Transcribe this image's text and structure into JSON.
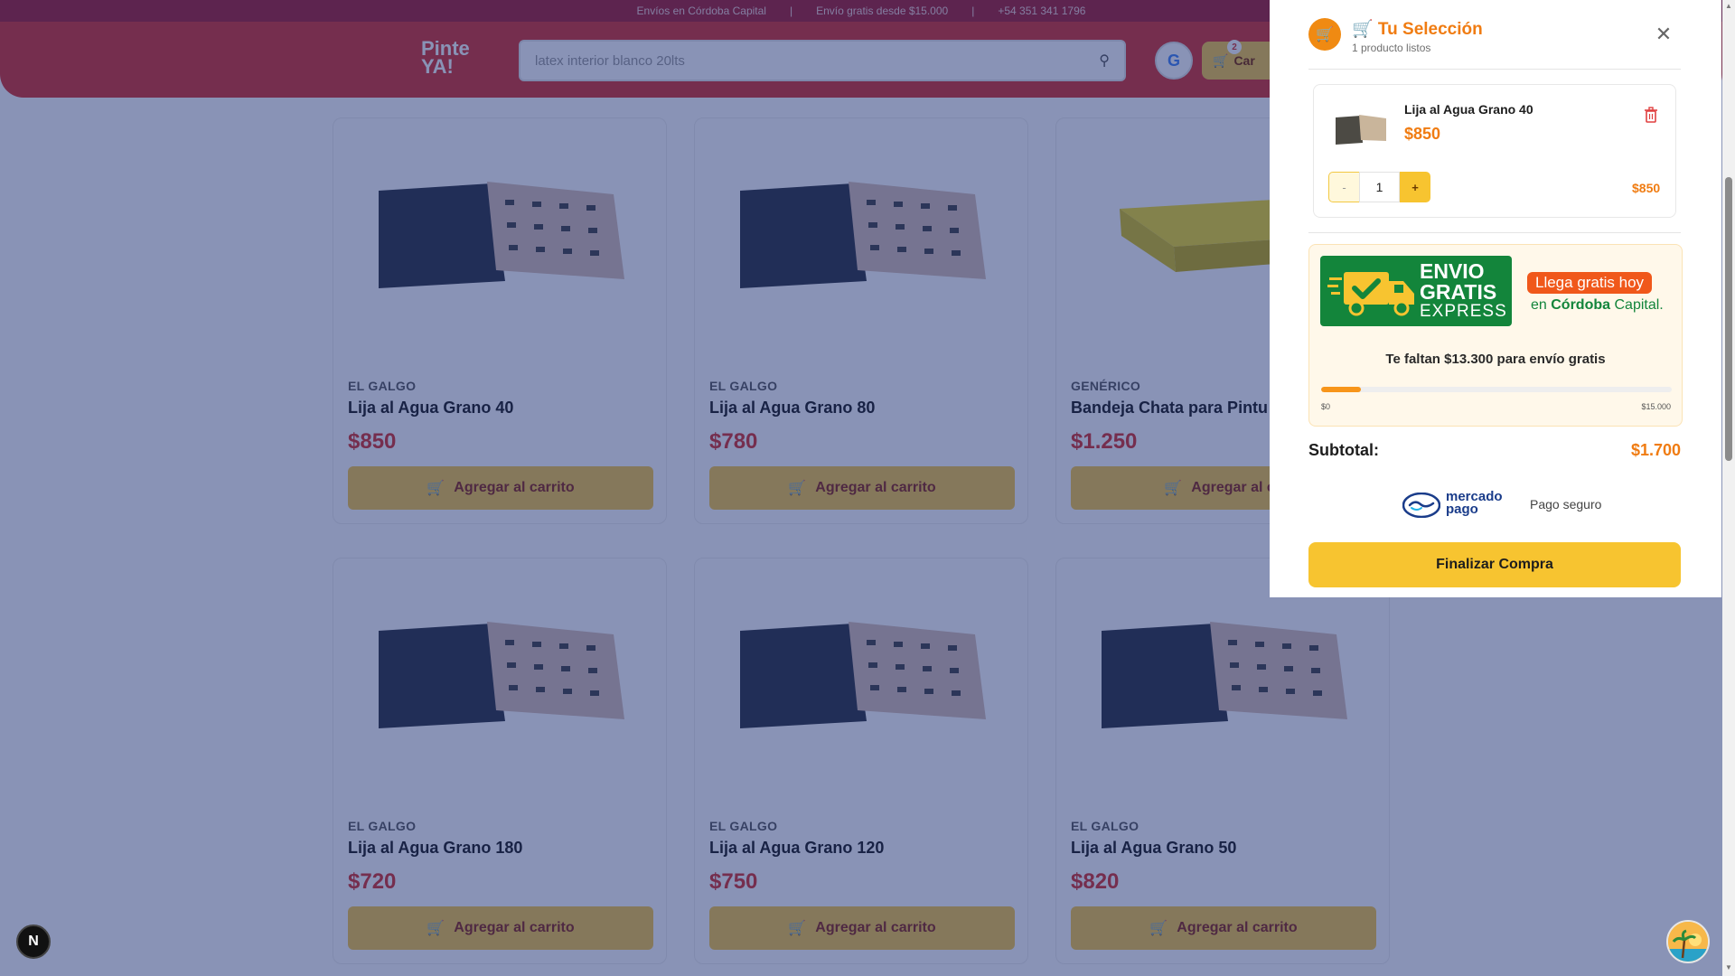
{
  "topbar": {
    "items": [
      "Envíos en Córdoba Capital",
      "Envío gratis desde $15.000",
      "+54 351 341 1796"
    ]
  },
  "header": {
    "logo_line1": "Pinte",
    "logo_line2": "YA!",
    "search_placeholder": "latex interior blanco 20lts",
    "cart_label": "Car",
    "cart_count": "2"
  },
  "products": [
    {
      "brand": "EL GALGO",
      "name": "Lija al Agua Grano 40",
      "price": "$850",
      "button": "Agregar al carrito"
    },
    {
      "brand": "EL GALGO",
      "name": "Lija al Agua Grano 80",
      "price": "$780",
      "button": "Agregar al carrito"
    },
    {
      "brand": "GENÉRICO",
      "name": "Bandeja Chata para Pintu",
      "price": "$1.250",
      "button": "Agregar al ca"
    },
    {
      "brand": "EL GALGO",
      "name": "Lija al Agua Grano 180",
      "price": "$720",
      "button": "Agregar al carrito"
    },
    {
      "brand": "EL GALGO",
      "name": "Lija al Agua Grano 120",
      "price": "$750",
      "button": "Agregar al carrito"
    },
    {
      "brand": "EL GALGO",
      "name": "Lija al Agua Grano 50",
      "price": "$820",
      "button": "Agregar al carrito"
    }
  ],
  "cart": {
    "title": "🛒 Tu Selección",
    "subtitle": "1 producto listos",
    "item": {
      "name": "Lija al Agua Grano 40",
      "price": "$850",
      "quantity": "1",
      "minus": "-",
      "plus": "+",
      "line_total": "$850"
    },
    "shipping": {
      "badge_line1": "ENVIO",
      "badge_line2": "GRATIS",
      "badge_line3": "EXPRESS",
      "llega": "Llega gratis hoy",
      "en": "en",
      "city_bold": "Córdoba",
      "city_rest": "Capital.",
      "remaining_text": "Te faltan $13.300 para envío gratis",
      "progress_fraction": 0.113,
      "min_label": "$0",
      "max_label": "$15.000"
    },
    "subtotal_label": "Subtotal:",
    "subtotal_value": "$1.700",
    "mp_line1": "mercado",
    "mp_line2": "pago",
    "pago_seguro": "Pago seguro",
    "checkout": "Finalizar Compra"
  },
  "floating": {
    "next_badge": "N"
  },
  "colors": {
    "brand_red": "#d6342f",
    "accent_orange": "#f07c12",
    "button_yellow": "#f7c430",
    "express_green": "#13853b"
  }
}
